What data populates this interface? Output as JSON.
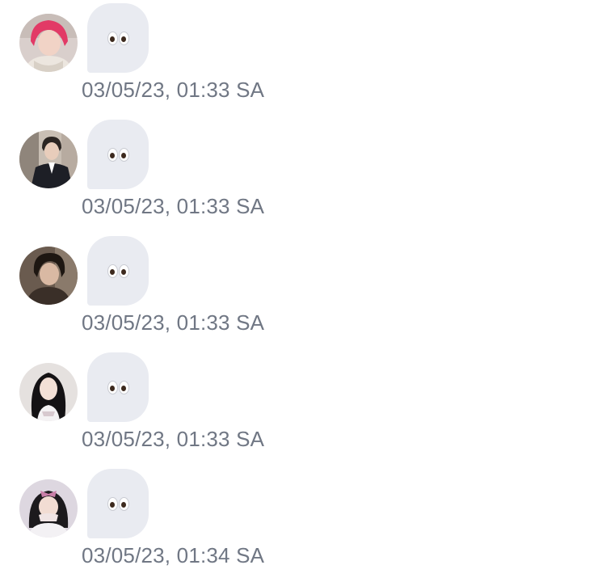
{
  "messages": [
    {
      "avatar": "avatar-pink-hair-person",
      "content_emoji": "eyes-emoji",
      "timestamp": "03/05/23, 01:33 SA"
    },
    {
      "avatar": "avatar-person-in-suit",
      "content_emoji": "eyes-emoji",
      "timestamp": "03/05/23, 01:33 SA"
    },
    {
      "avatar": "avatar-dark-hair-person",
      "content_emoji": "eyes-emoji",
      "timestamp": "03/05/23, 01:33 SA"
    },
    {
      "avatar": "avatar-long-hair-person",
      "content_emoji": "eyes-emoji",
      "timestamp": "03/05/23, 01:33 SA"
    },
    {
      "avatar": "avatar-person-with-bow",
      "content_emoji": "eyes-emoji",
      "timestamp": "03/05/23, 01:34 SA"
    }
  ],
  "colors": {
    "bubble": "#e9ebf1",
    "timestamp_text": "#707784",
    "background": "#ffffff"
  }
}
